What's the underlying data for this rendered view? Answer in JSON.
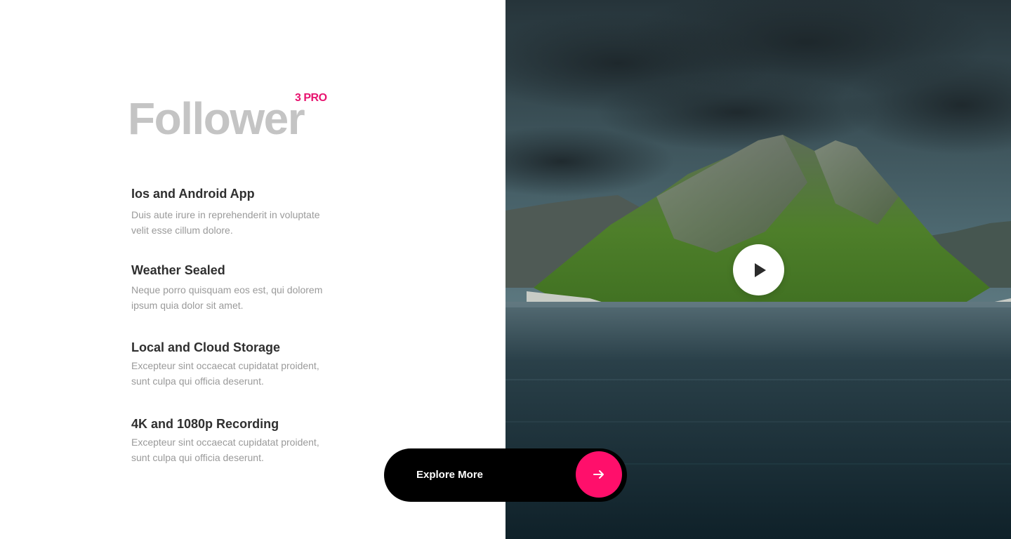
{
  "brand": {
    "title": "Follower",
    "badge": "3 PRO"
  },
  "features": [
    {
      "title": "Ios and Android App",
      "line1": "Duis aute irure in reprehenderit in voluptate",
      "line2": "velit esse cillum dolore."
    },
    {
      "title": "Weather Sealed",
      "line1": "Neque porro quisquam eos est, qui dolorem",
      "line2": "ipsum quia dolor sit amet."
    },
    {
      "title": "Local and Cloud Storage",
      "line1": "Excepteur sint occaecat cupidatat proident,",
      "line2": "sunt culpa qui officia deserunt."
    },
    {
      "title": "4K and 1080p Recording",
      "line1": "Excepteur sint occaecat cupidatat proident,",
      "line2": "sunt culpa qui officia deserunt."
    }
  ],
  "cta": {
    "label": "Explore More",
    "icon": "arrow-right-icon"
  },
  "media": {
    "play_icon": "play-icon"
  },
  "colors": {
    "accent": "#ff0f6b",
    "badge": "#e8136f",
    "title_gray": "#c4c4c4",
    "heading": "#2f2f2f",
    "body_text": "#9a9a9a",
    "button_bg": "#000000"
  }
}
